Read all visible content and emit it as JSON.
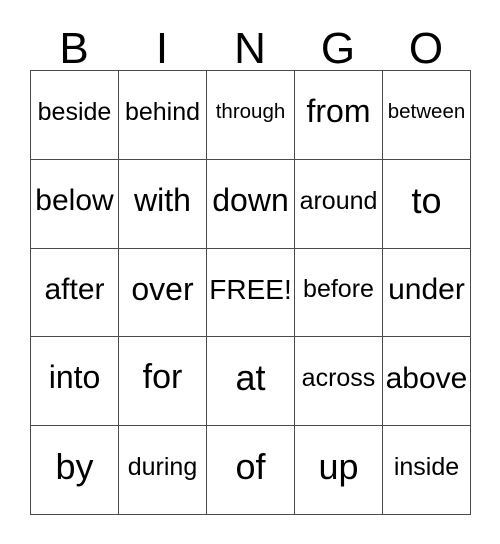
{
  "card": {
    "title": "BINGO",
    "headers": [
      "B",
      "I",
      "N",
      "G",
      "O"
    ],
    "rows": [
      [
        {
          "text": "beside"
        },
        {
          "text": "behind"
        },
        {
          "text": "through"
        },
        {
          "text": "from"
        },
        {
          "text": "between"
        }
      ],
      [
        {
          "text": "below"
        },
        {
          "text": "with"
        },
        {
          "text": "down"
        },
        {
          "text": "around"
        },
        {
          "text": "to"
        }
      ],
      [
        {
          "text": "after"
        },
        {
          "text": "over"
        },
        {
          "text": "FREE!"
        },
        {
          "text": "before"
        },
        {
          "text": "under"
        }
      ],
      [
        {
          "text": "into"
        },
        {
          "text": "for"
        },
        {
          "text": "at"
        },
        {
          "text": "across"
        },
        {
          "text": "above"
        }
      ],
      [
        {
          "text": "by"
        },
        {
          "text": "during"
        },
        {
          "text": "of"
        },
        {
          "text": "up"
        },
        {
          "text": "inside"
        }
      ]
    ],
    "free_space": "FREE!",
    "colors": {
      "background": "#ffffff",
      "text": "#000000",
      "grid_line": "#4a4a4a"
    }
  }
}
